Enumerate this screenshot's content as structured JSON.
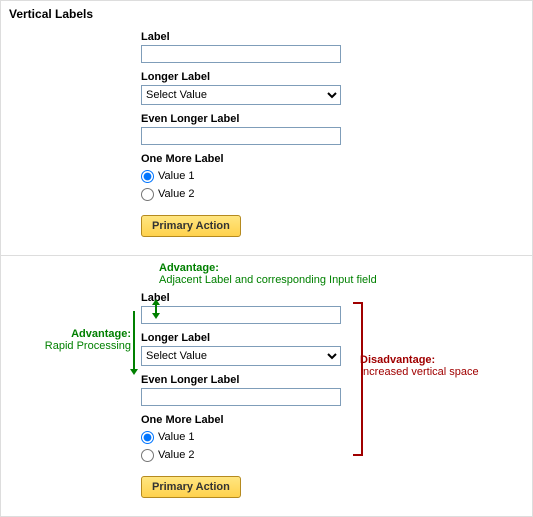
{
  "section_title": "Vertical Labels",
  "form": {
    "label1": "Label",
    "value1": "",
    "label2": "Longer Label",
    "select_value": "Select Value",
    "label3": "Even Longer Label",
    "value3": "",
    "label4": "One More Label",
    "radio1": "Value 1",
    "radio2": "Value 2",
    "primary_action": "Primary Action"
  },
  "anno": {
    "adv_top_t1": "Advantage:",
    "adv_top_t2": "Adjacent Label and corresponding Input field",
    "adv_left_t1": "Advantage:",
    "adv_left_t2": "Rapid Processing",
    "dis_t1": "Disadvantage:",
    "dis_t2": "Increased vertical space"
  }
}
